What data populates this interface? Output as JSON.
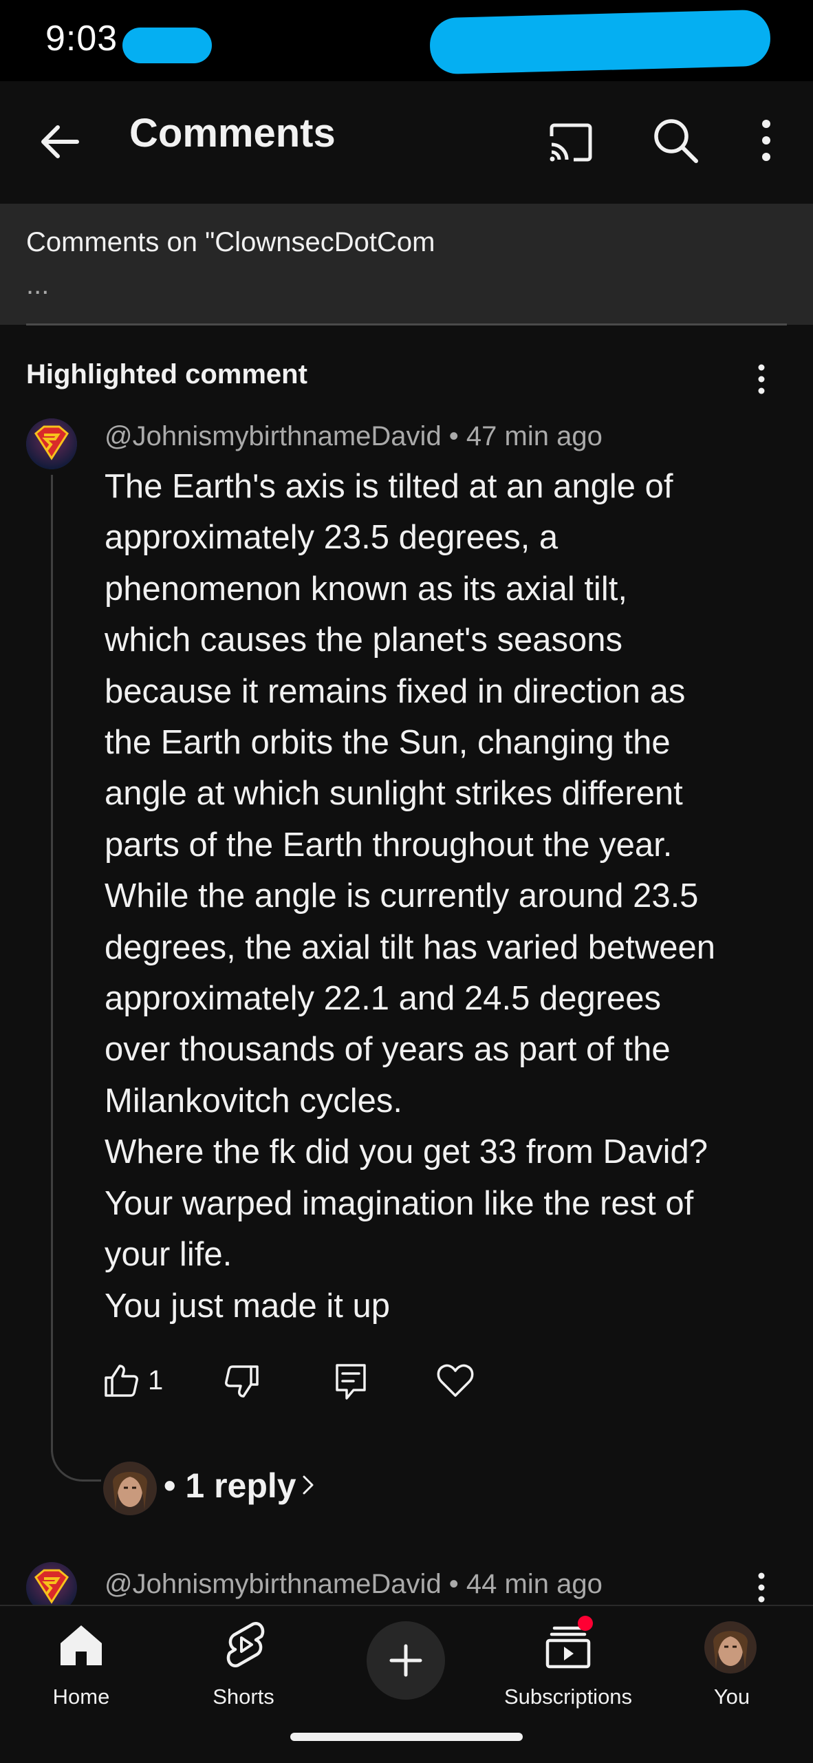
{
  "status_bar": {
    "time": "9:03"
  },
  "app_bar": {
    "title": "Comments",
    "back_icon": "arrow-left-icon",
    "cast_icon": "cast-icon",
    "search_icon": "search-icon",
    "more_icon": "more-vert-icon"
  },
  "context": {
    "text": "Comments on \"ClownsecDotCom",
    "ellipsis": "..."
  },
  "highlighted_comment": {
    "label": "Highlighted comment",
    "author": "@JohnismybirthnameDavid",
    "separator": " • ",
    "time": "47 min ago",
    "body": "The Earth's axis is tilted at an angle of\napproximately 23.5 degrees, a\nphenomenon known as its axial tilt,\nwhich causes the planet's seasons\nbecause it remains fixed in direction as\nthe Earth orbits the Sun, changing the\nangle at which sunlight strikes different\nparts of the Earth throughout the year.\nWhile the angle is currently around 23.5\ndegrees, the axial tilt has varied between\napproximately 22.1 and 24.5 degrees\nover thousands of years as part of the\nMilankovitch cycles.\nWhere the fk did you get 33 from David?\nYour warped imagination like the rest of\nyour life.\nYou just made it up",
    "like_count": "1",
    "reply_text": "• 1 reply"
  },
  "next_comment": {
    "author": "@JohnismybirthnameDavid",
    "separator": " • ",
    "time": "44 min ago"
  },
  "bottom_nav": {
    "items": [
      {
        "label": "Home",
        "icon": "home-icon"
      },
      {
        "label": "Shorts",
        "icon": "shorts-icon"
      },
      {
        "label": "",
        "icon": "create-plus-icon"
      },
      {
        "label": "Subscriptions",
        "icon": "subscriptions-icon"
      },
      {
        "label": "You",
        "icon": "avatar"
      }
    ]
  },
  "colors": {
    "background": "#0f0f0f",
    "header": "#272727",
    "text_primary": "#f1f1f1",
    "text_secondary": "#aaaaaa",
    "notification_dot": "#ff0033"
  }
}
